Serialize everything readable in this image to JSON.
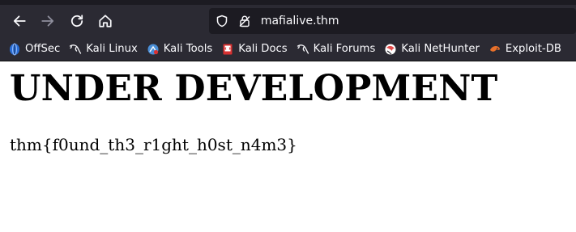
{
  "browser": {
    "url": "mafialive.thm"
  },
  "bookmarks": [
    {
      "label": "OffSec",
      "icon": "offsec-icon",
      "color": "#2b6fd8"
    },
    {
      "label": "Kali Linux",
      "icon": "kali-dragon-icon",
      "color": "#fbfbfe"
    },
    {
      "label": "Kali Tools",
      "icon": "kali-tools-icon",
      "color": "#4a8ed6"
    },
    {
      "label": "Kali Docs",
      "icon": "kali-docs-icon",
      "color": "#d83131"
    },
    {
      "label": "Kali Forums",
      "icon": "kali-dragon-icon",
      "color": "#fbfbfe"
    },
    {
      "label": "Kali NetHunter",
      "icon": "nethunter-icon",
      "color": "#e34b4b"
    },
    {
      "label": "Exploit-DB",
      "icon": "exploitdb-icon",
      "color": "#e8702a"
    }
  ],
  "page": {
    "heading": "UNDER DEVELOPMENT",
    "flag": "thm{f0und_th3_r1ght_h0st_n4m3}"
  }
}
